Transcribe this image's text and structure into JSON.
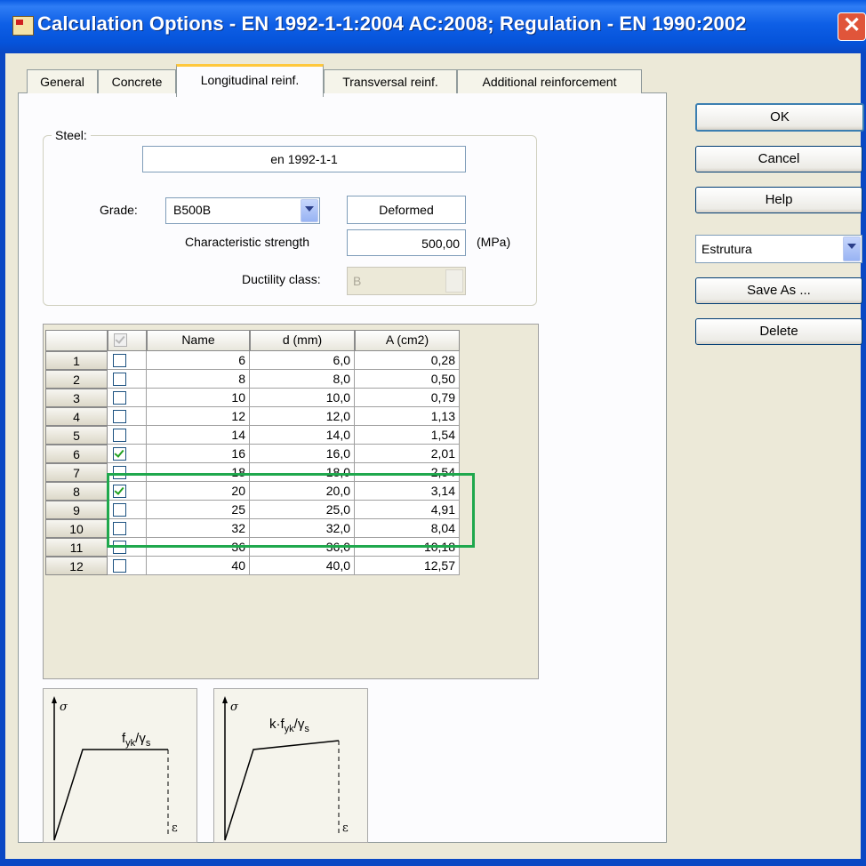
{
  "window": {
    "title": "Calculation Options - EN 1992-1-1:2004 AC:2008;  Regulation - EN 1990:2002",
    "close_glyph": "✕"
  },
  "tabs": [
    {
      "label": "General"
    },
    {
      "label": "Concrete"
    },
    {
      "label": "Longitudinal reinf."
    },
    {
      "label": "Transversal reinf."
    },
    {
      "label": "Additional reinforcement"
    }
  ],
  "steel": {
    "group_label": "Steel:",
    "standard": "en 1992-1-1",
    "grade_label": "Grade:",
    "grade_value": "B500B",
    "surface": "Deformed",
    "char_strength_label": "Characteristic strength",
    "char_strength_value": "500,00",
    "char_strength_unit": "(MPa)",
    "ductility_label": "Ductility class:",
    "ductility_value": "B"
  },
  "table": {
    "headers": [
      "",
      "",
      "Name",
      "d (mm)",
      "A (cm2)"
    ],
    "rows": [
      {
        "idx": "1",
        "checked": false,
        "name": "6",
        "d": "6,0",
        "a": "0,28"
      },
      {
        "idx": "2",
        "checked": false,
        "name": "8",
        "d": "8,0",
        "a": "0,50"
      },
      {
        "idx": "3",
        "checked": false,
        "name": "10",
        "d": "10,0",
        "a": "0,79"
      },
      {
        "idx": "4",
        "checked": false,
        "name": "12",
        "d": "12,0",
        "a": "1,13"
      },
      {
        "idx": "5",
        "checked": false,
        "name": "14",
        "d": "14,0",
        "a": "1,54"
      },
      {
        "idx": "6",
        "checked": true,
        "name": "16",
        "d": "16,0",
        "a": "2,01"
      },
      {
        "idx": "7",
        "checked": false,
        "name": "18",
        "d": "18,0",
        "a": "2,54"
      },
      {
        "idx": "8",
        "checked": true,
        "name": "20",
        "d": "20,0",
        "a": "3,14"
      },
      {
        "idx": "9",
        "checked": false,
        "name": "25",
        "d": "25,0",
        "a": "4,91"
      },
      {
        "idx": "10",
        "checked": false,
        "name": "32",
        "d": "32,0",
        "a": "8,04"
      },
      {
        "idx": "11",
        "checked": false,
        "name": "36",
        "d": "36,0",
        "a": "10,18"
      },
      {
        "idx": "12",
        "checked": false,
        "name": "40",
        "d": "40,0",
        "a": "12,57"
      }
    ]
  },
  "diagrams": {
    "left": {
      "sigma": "σ",
      "epsilon": "ε",
      "label_main": "f",
      "label_sub1": "yk",
      "label_sep": "/γ",
      "label_sub2": "s"
    },
    "right": {
      "sigma": "σ",
      "epsilon": "ε",
      "label_main": "k·f",
      "label_sub1": "yk",
      "label_sep": "/γ",
      "label_sub2": "s"
    }
  },
  "buttons": {
    "ok": "OK",
    "cancel": "Cancel",
    "help": "Help",
    "save_as": "Save As ...",
    "delete": "Delete"
  },
  "preset": {
    "value": "Estrutura"
  },
  "colors": {
    "highlight": "#1fa84d",
    "titlebar": "#0553da"
  }
}
